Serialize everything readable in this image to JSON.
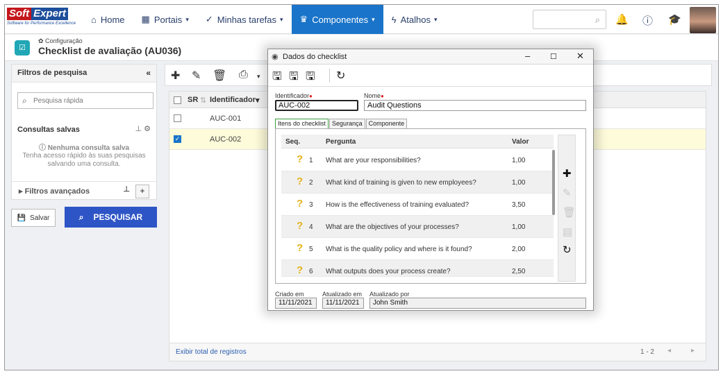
{
  "brand": {
    "word1": "Soft",
    "word2": "Expert",
    "tagline": "Software for Performance Excellence",
    "red": "#c4161c",
    "blue": "#1d4e9b"
  },
  "nav": [
    {
      "label": "Home",
      "icon": "home-icon",
      "glyph": "⌂",
      "caret": ""
    },
    {
      "label": "Portais",
      "icon": "grid-icon",
      "glyph": "▦",
      "caret": "▾"
    },
    {
      "label": "Minhas tarefas",
      "icon": "check-icon",
      "glyph": "✓",
      "caret": "▾"
    },
    {
      "label": "Componentes",
      "icon": "trophy-icon",
      "glyph": "🏆",
      "caret": "▾"
    },
    {
      "label": "Atalhos",
      "icon": "bolt-icon",
      "glyph": "⚡",
      "caret": "▾"
    }
  ],
  "accent": "#1a74c9",
  "page": {
    "breadcrumb": "✿ Configuração",
    "title": "Checklist de avaliação (AU036)"
  },
  "filters": {
    "title": "Filtros de pesquisa",
    "quick_placeholder": "Pesquisa rápida",
    "saved_label": "Consultas salvas",
    "empty_title": "Nenhuma consulta salva",
    "empty_line1": "Tenha acesso rápido às suas pesquisas",
    "empty_line2": "salvando uma consulta.",
    "advanced_label": "Filtros avançados"
  },
  "buttons": {
    "save": "Salvar",
    "search": "PESQUISAR"
  },
  "grid": {
    "col_sr": "SR",
    "col_id": "Identificador",
    "rows": [
      {
        "id": "AUC-001",
        "checked": false
      },
      {
        "id": "AUC-002",
        "checked": true
      }
    ],
    "footer_link": "Exibir total de registros",
    "pager": "1 - 2"
  },
  "dialog": {
    "title": "Dados do checklist",
    "id_label": "Identificador",
    "id_value": "AUC-002",
    "name_label": "Nome",
    "name_value": "Audit Questions",
    "tabs": [
      "Itens do checklist",
      "Segurança",
      "Componente"
    ],
    "cols": {
      "seq": "Seq.",
      "question": "Pergunta",
      "value": "Valor"
    },
    "items": [
      {
        "seq": "1",
        "question": "What are your responsibilities?",
        "value": "1,00"
      },
      {
        "seq": "2",
        "question": "What kind of training is given to new employees?",
        "value": "1,00"
      },
      {
        "seq": "3",
        "question": "How is the effectiveness of training evaluated?",
        "value": "3,50"
      },
      {
        "seq": "4",
        "question": "What are the objectives of your processes?",
        "value": "1,00"
      },
      {
        "seq": "5",
        "question": "What is the quality policy and where is it found?",
        "value": "2,00"
      },
      {
        "seq": "6",
        "question": "What outputs does your process create?",
        "value": "2,50"
      }
    ],
    "created_label": "Criado em",
    "created_value": "11/11/2021",
    "updated_label": "Atualizado em",
    "updated_value": "11/11/2021",
    "updated_by_label": "Atualizado por",
    "updated_by_value": "John Smith"
  }
}
